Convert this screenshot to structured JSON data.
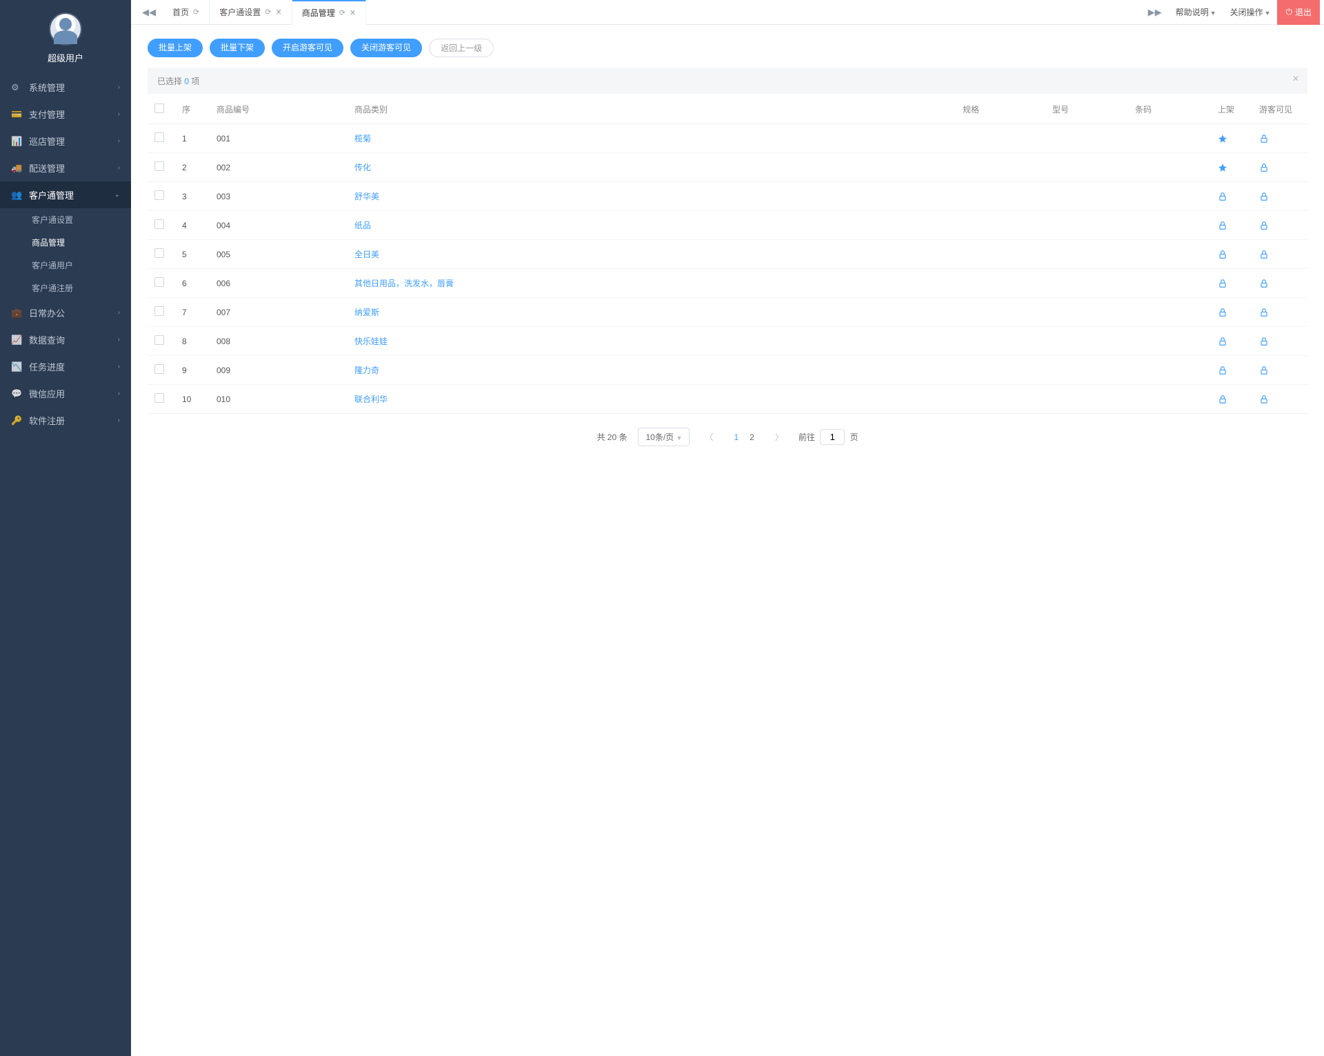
{
  "user": {
    "name": "超级用户"
  },
  "sidebar": {
    "items": [
      {
        "label": "系统管理",
        "icon": "cogs"
      },
      {
        "label": "支付管理",
        "icon": "card"
      },
      {
        "label": "巡店管理",
        "icon": "sitemap"
      },
      {
        "label": "配送管理",
        "icon": "truck"
      },
      {
        "label": "客户通管理",
        "icon": "users",
        "expanded": true,
        "children": [
          {
            "label": "客户通设置"
          },
          {
            "label": "商品管理",
            "current": true
          },
          {
            "label": "客户通用户"
          },
          {
            "label": "客户通注册"
          }
        ]
      },
      {
        "label": "日常办公",
        "icon": "briefcase"
      },
      {
        "label": "数据查询",
        "icon": "bars"
      },
      {
        "label": "任务进度",
        "icon": "chart"
      },
      {
        "label": "微信应用",
        "icon": "wechat"
      },
      {
        "label": "软件注册",
        "icon": "key"
      }
    ]
  },
  "tabs": [
    {
      "label": "首页"
    },
    {
      "label": "客户通设置"
    },
    {
      "label": "商品管理",
      "active": true
    }
  ],
  "header_right": {
    "help": "帮助说明",
    "close_op": "关闭操作",
    "exit": "退出"
  },
  "actions": {
    "batch_on": "批量上架",
    "batch_off": "批量下架",
    "vis_on": "开启游客可见",
    "vis_off": "关闭游客可见",
    "back_up": "返回上一级"
  },
  "selection": {
    "prefix": "已选择 ",
    "count": "0",
    "suffix": " 项"
  },
  "columns": {
    "seq": "序",
    "code": "商品编号",
    "cat": "商品类别",
    "spec": "规格",
    "model": "型号",
    "barcode": "条码",
    "onshelf": "上架",
    "guest": "游客可见"
  },
  "rows": [
    {
      "seq": "1",
      "code": "001",
      "cat": "榄菊",
      "on_icon": "star",
      "guest_icon": "lock"
    },
    {
      "seq": "2",
      "code": "002",
      "cat": "传化",
      "on_icon": "star",
      "guest_icon": "lock"
    },
    {
      "seq": "3",
      "code": "003",
      "cat": "舒华美",
      "on_icon": "lock",
      "guest_icon": "lock"
    },
    {
      "seq": "4",
      "code": "004",
      "cat": "纸品",
      "on_icon": "lock",
      "guest_icon": "lock"
    },
    {
      "seq": "5",
      "code": "005",
      "cat": "全日美",
      "on_icon": "lock",
      "guest_icon": "lock"
    },
    {
      "seq": "6",
      "code": "006",
      "cat": "其他日用品，洗发水，唇膏",
      "on_icon": "lock",
      "guest_icon": "lock"
    },
    {
      "seq": "7",
      "code": "007",
      "cat": "纳爱斯",
      "on_icon": "lock",
      "guest_icon": "lock"
    },
    {
      "seq": "8",
      "code": "008",
      "cat": "快乐娃娃",
      "on_icon": "lock",
      "guest_icon": "lock"
    },
    {
      "seq": "9",
      "code": "009",
      "cat": "隆力奇",
      "on_icon": "lock",
      "guest_icon": "lock"
    },
    {
      "seq": "10",
      "code": "010",
      "cat": "联合利华",
      "on_icon": "lock",
      "guest_icon": "lock"
    }
  ],
  "pager": {
    "total": "共 20 条",
    "per_page": "10条/页",
    "pages": [
      "1",
      "2"
    ],
    "current_page": "1",
    "goto_prefix": "前往",
    "goto_suffix": "页",
    "goto_value": "1"
  }
}
